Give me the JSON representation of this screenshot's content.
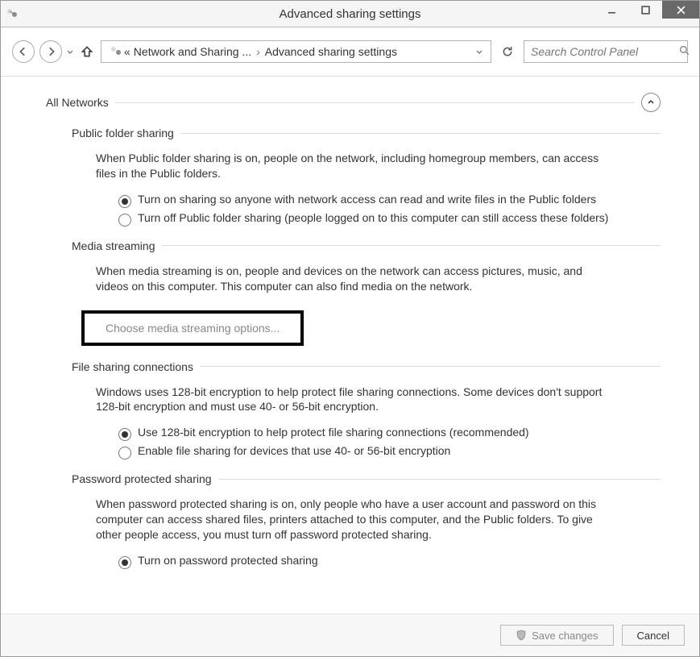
{
  "window": {
    "title": "Advanced sharing settings"
  },
  "breadcrumb": {
    "prefix": "«",
    "item1": "Network and Sharing ...",
    "item2": "Advanced sharing settings"
  },
  "search": {
    "placeholder": "Search Control Panel"
  },
  "section": {
    "title": "All Networks"
  },
  "public_folder": {
    "title": "Public folder sharing",
    "desc": "When Public folder sharing is on, people on the network, including homegroup members, can access files in the Public folders.",
    "opt1": "Turn on sharing so anyone with network access can read and write files in the Public folders",
    "opt2": "Turn off Public folder sharing (people logged on to this computer can still access these folders)",
    "selected": 0
  },
  "media": {
    "title": "Media streaming",
    "desc": "When media streaming is on, people and devices on the network can access pictures, music, and videos on this computer. This computer can also find media on the network.",
    "link": "Choose media streaming options..."
  },
  "file_conn": {
    "title": "File sharing connections",
    "desc": "Windows uses 128-bit encryption to help protect file sharing connections. Some devices don't support 128-bit encryption and must use 40- or 56-bit encryption.",
    "opt1": "Use 128-bit encryption to help protect file sharing connections (recommended)",
    "opt2": "Enable file sharing for devices that use 40- or 56-bit encryption",
    "selected": 0
  },
  "password": {
    "title": "Password protected sharing",
    "desc": "When password protected sharing is on, only people who have a user account and password on this computer can access shared files, printers attached to this computer, and the Public folders. To give other people access, you must turn off password protected sharing.",
    "opt1": "Turn on password protected sharing",
    "selected": 0
  },
  "footer": {
    "save": "Save changes",
    "cancel": "Cancel"
  }
}
